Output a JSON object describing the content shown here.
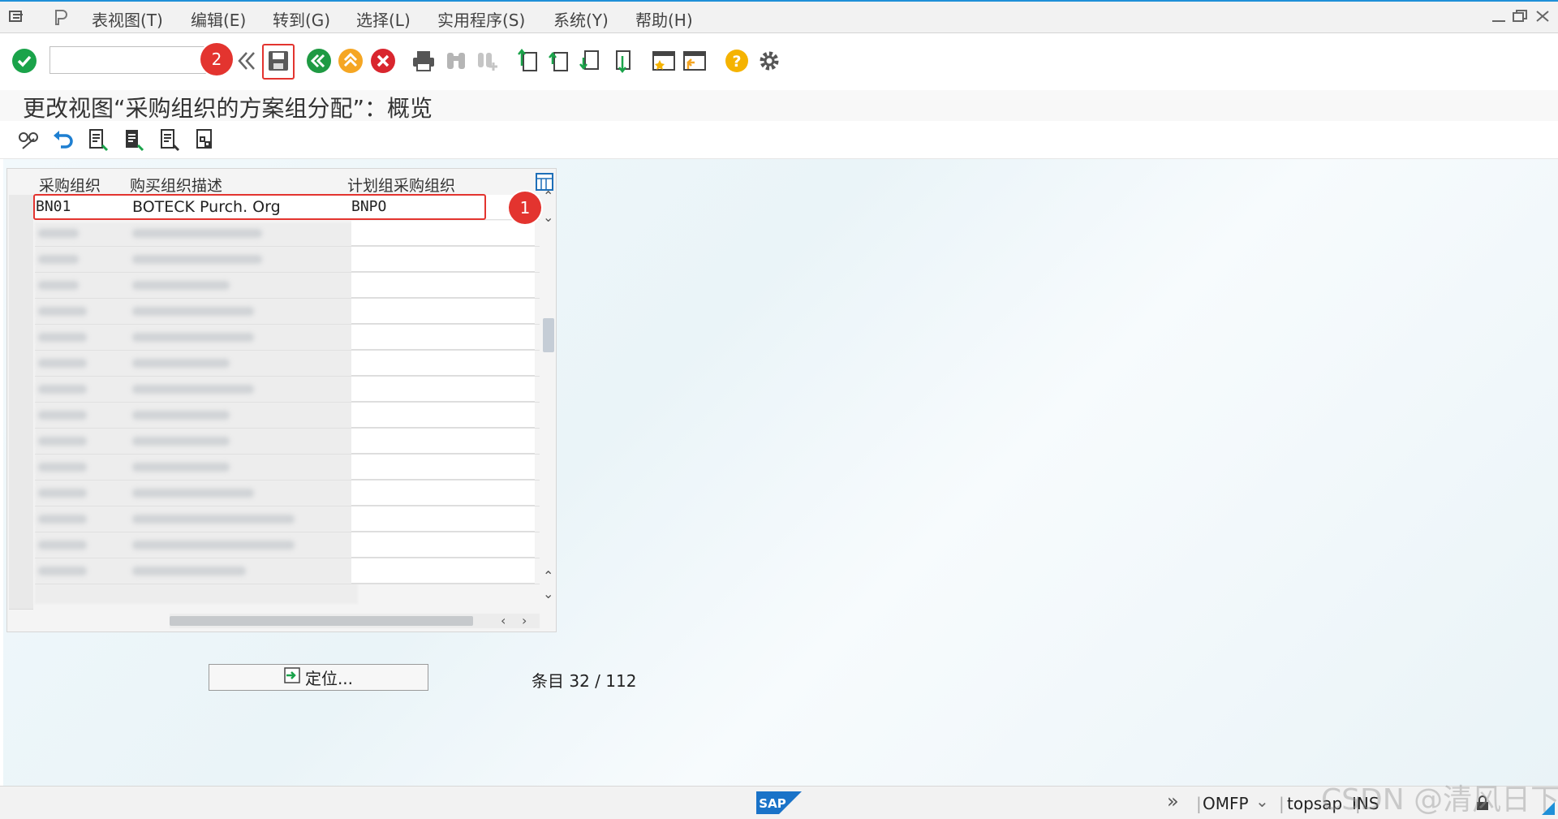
{
  "menubar": {
    "items": [
      "表视图(T)",
      "编辑(E)",
      "转到(G)",
      "选择(L)",
      "实用程序(S)",
      "系统(Y)",
      "帮助(H)"
    ]
  },
  "toolbar": {
    "command_field_value": "",
    "marker_save": "2"
  },
  "title": "更改视图“采购组织的方案组分配”：概览",
  "table": {
    "headers": [
      "采购组织",
      "购买组织描述",
      "计划组采购组织"
    ],
    "rows": [
      {
        "purch_org": "BN01",
        "description": "BOTECK Purch. Org",
        "plan_group": "BNPO"
      }
    ],
    "marker_row": "1"
  },
  "locate_button_label": "定位...",
  "entries": "条目 32 / 112",
  "statusbar": {
    "transaction": "OMFP",
    "server": "topsap",
    "mode": "INS",
    "sap_logo": "SAP"
  },
  "watermark": "CSDN @清风日下",
  "colors": {
    "accent_blue": "#1e90d8",
    "marker_red": "#e3342f",
    "ok_green": "#1aa34a",
    "nav_green": "#1f9a43",
    "nav_orange": "#f5a623",
    "cancel_red": "#d9262e",
    "help_yellow": "#f5b301"
  }
}
